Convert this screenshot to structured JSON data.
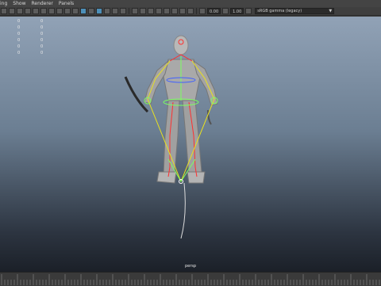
{
  "menu": [
    "ing",
    "Show",
    "Renderer",
    "Panels"
  ],
  "toolbar": {
    "exposure_value": "0.00",
    "gamma_value": "1.00",
    "color_space": "sRGB gamma (legacy)"
  },
  "hud": {
    "col1": [
      "0",
      "0",
      "0",
      "0",
      "0",
      "0"
    ],
    "col2": [
      "0",
      "0",
      "0",
      "0",
      "0",
      "0"
    ]
  },
  "viewport": {
    "camera": "persp"
  },
  "colors": {
    "viewport_top": "#91a2b6",
    "viewport_bottom": "#1b2028",
    "skeleton_red": "#ff3030",
    "skeleton_green": "#7cff60",
    "skeleton_yellow": "#e8e020",
    "skeleton_blue": "#4060ff"
  }
}
